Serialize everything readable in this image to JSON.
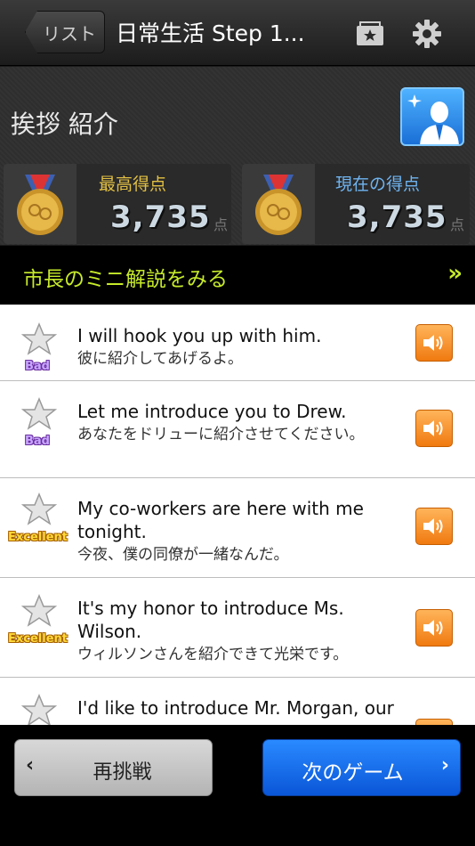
{
  "nav": {
    "back_label": "リスト",
    "title": "日常生活 Step 1...",
    "bookmark_icon": "bookmark-star-icon",
    "settings_icon": "gear-icon"
  },
  "lesson": {
    "title": "挨拶 紹介"
  },
  "scores": {
    "best_label": "最高得点",
    "best_value": "3,735",
    "current_label": "現在の得点",
    "current_value": "3,735",
    "unit": "点"
  },
  "commentary": {
    "label": "市長のミニ解説をみる",
    "chevron": "»"
  },
  "phrases": [
    {
      "en": "I will hook you up with him.",
      "ja": "彼に紹介してあげるよ。",
      "rating": "Bad"
    },
    {
      "en": "Let me introduce you to Drew.",
      "ja": "あなたをドリューに紹介させてください。",
      "rating": "Bad"
    },
    {
      "en": "My co-workers are here with me tonight.",
      "ja": "今夜、僕の同僚が一緒なんだ。",
      "rating": "Excellent"
    },
    {
      "en": "It's my honor to introduce Ms. Wilson.",
      "ja": "ウィルソンさんを紹介できて光栄です。",
      "rating": "Excellent"
    },
    {
      "en": "I'd like to introduce Mr. Morgan, our",
      "ja": "",
      "rating": ""
    }
  ],
  "buttons": {
    "retry": "再挑戦",
    "next": "次のゲーム"
  },
  "colors": {
    "accent_green": "#c6ea2a",
    "next_blue": "#1a6fea",
    "sound_orange": "#f58a1f"
  }
}
